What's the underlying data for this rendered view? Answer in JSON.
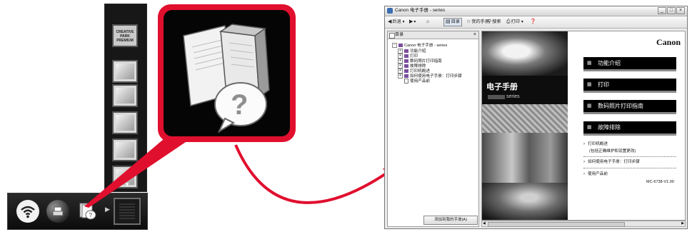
{
  "solution_menu": {
    "vertical_tiles": [
      {
        "name": "creative-park-premium",
        "label": "CREATIVE PARK PREMIUM"
      },
      {
        "name": "photo-print"
      },
      {
        "name": "scan-app"
      },
      {
        "name": "layout-app"
      },
      {
        "name": "photo-app"
      },
      {
        "name": "card-app"
      }
    ],
    "bar_apps": [
      "wifi-icon",
      "web-print-icon",
      "manual-icon"
    ]
  },
  "zoom": {
    "icon": "e-manual-book-question-icon",
    "accent": "#e10f2e"
  },
  "help_window": {
    "title": "Canon 电子手册 -            series",
    "controls": {
      "minimize": "_",
      "maximize": "□",
      "close": "×"
    },
    "toolbar": {
      "back": "后退",
      "forward": "",
      "toc": "目录",
      "favorites": "我的手册",
      "search": "搜索",
      "print": "打印"
    },
    "toc_pane": {
      "header": "目录",
      "close": "×",
      "root": "Canon 电子手册 -            series",
      "items": [
        "功能介绍",
        "打印",
        "数码照片打印指南",
        "故障排除",
        "打印机概述",
        "如何使用电子手册：打印步骤",
        "使用产品前"
      ],
      "bottom_button": "添加到我的手册(A)"
    },
    "content": {
      "brand": "Canon",
      "manual_title": "电子手册",
      "series": "series",
      "menu_buttons": [
        "功能介绍",
        "打印",
        "数码照片打印指南",
        "故障排除"
      ],
      "links": [
        "打印机概述",
        "(包括正确维护和设置更改)",
        "如何使用电子手册：打印步骤",
        "使用产品前"
      ],
      "version": "MC-6738-V1.00"
    }
  }
}
